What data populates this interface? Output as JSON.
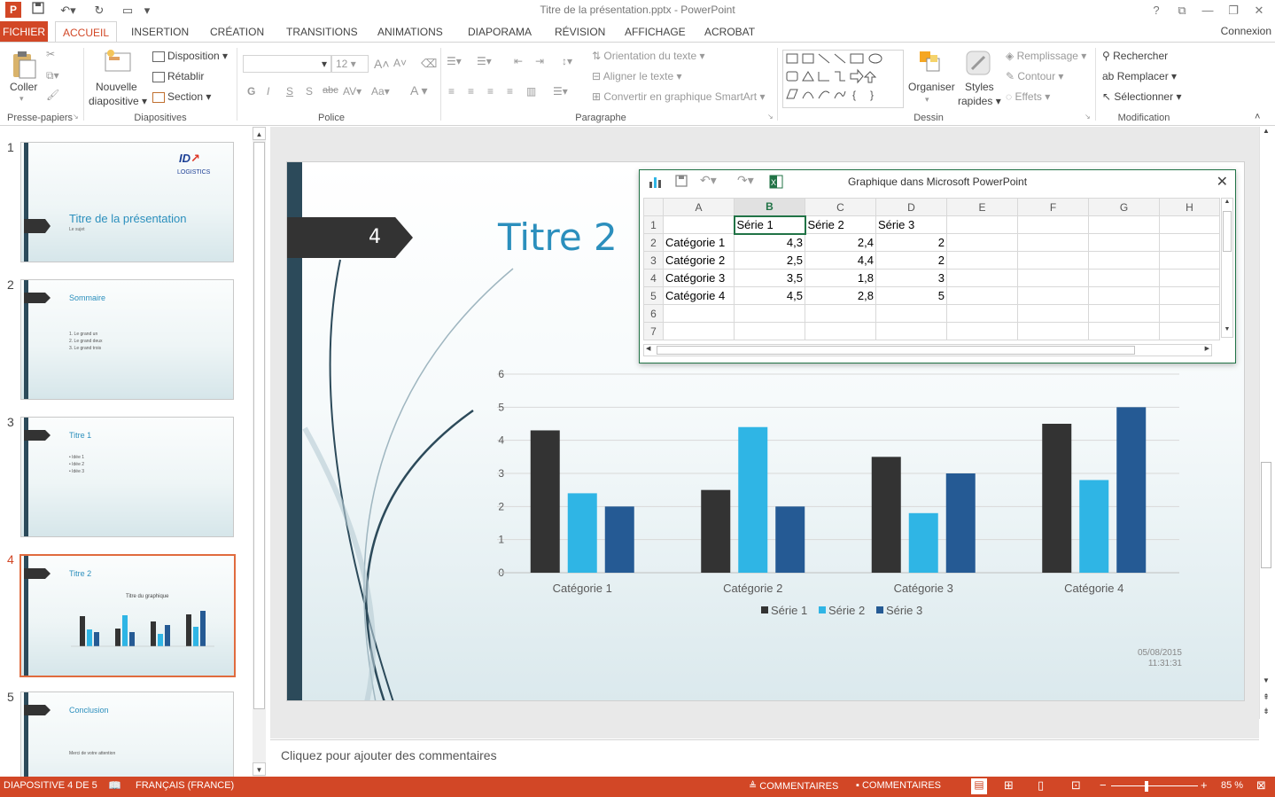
{
  "window": {
    "title": "Titre de la présentation.pptx - PowerPoint",
    "help": "?",
    "controls": [
      "?",
      "⧉",
      "—",
      "❐",
      "✕"
    ]
  },
  "tabs": [
    "FICHIER",
    "ACCUEIL",
    "INSERTION",
    "CRÉATION",
    "TRANSITIONS",
    "ANIMATIONS",
    "DIAPORAMA",
    "RÉVISION",
    "AFFICHAGE",
    "ACROBAT"
  ],
  "connexion": "Connexion",
  "ribbon": {
    "clipboard": {
      "paste": "Coller",
      "label": "Presse-papiers"
    },
    "slides": {
      "new_slide_1": "Nouvelle",
      "new_slide_2": "diapositive",
      "layout": "Disposition",
      "reset": "Rétablir",
      "section": "Section",
      "label": "Diapositives"
    },
    "font": {
      "size": "12",
      "bold": "G",
      "italic": "I",
      "underline": "S",
      "shadow": "S",
      "strike": "abc",
      "spacing": "AV",
      "case": "Aa",
      "color": "A",
      "label": "Police"
    },
    "paragraph": {
      "orientation": "Orientation du texte",
      "align": "Aligner le texte",
      "smartart": "Convertir en graphique SmartArt",
      "label": "Paragraphe"
    },
    "drawing": {
      "arrange": "Organiser",
      "styles_1": "Styles",
      "styles_2": "rapides",
      "fill": "Remplissage",
      "outline": "Contour",
      "effects": "Effets",
      "label": "Dessin"
    },
    "editing": {
      "find": "Rechercher",
      "replace": "Remplacer",
      "select": "Sélectionner",
      "label": "Modification"
    }
  },
  "thumbnails": [
    {
      "num": "1",
      "title": "Titre de la présentation",
      "sub": "Le sujet",
      "logo": "ID LOGISTICS"
    },
    {
      "num": "2",
      "title": "Sommaire",
      "items": [
        "1. Le grand un",
        "2. Le grand deux",
        "3. Le grand trois"
      ]
    },
    {
      "num": "3",
      "title": "Titre 1",
      "items": [
        "Idée 1",
        "Idée 2",
        "Idée 3"
      ]
    },
    {
      "num": "4",
      "title": "Titre 2",
      "chart_title": "Titre du graphique"
    },
    {
      "num": "5",
      "title": "Conclusion",
      "body": "Merci de votre attention"
    }
  ],
  "slide": {
    "number": "4",
    "title": "Titre 2",
    "date": "05/08/2015",
    "time": "11:31:31"
  },
  "datawindow": {
    "title": "Graphique dans Microsoft PowerPoint",
    "columns": [
      "",
      "A",
      "B",
      "C",
      "D",
      "E",
      "F",
      "G",
      "H"
    ],
    "rows": [
      [
        "1",
        "",
        "Série 1",
        "Série 2",
        "Série 3",
        "",
        "",
        "",
        ""
      ],
      [
        "2",
        "Catégorie 1",
        "4,3",
        "2,4",
        "2",
        "",
        "",
        "",
        ""
      ],
      [
        "3",
        "Catégorie 2",
        "2,5",
        "4,4",
        "2",
        "",
        "",
        "",
        ""
      ],
      [
        "4",
        "Catégorie 3",
        "3,5",
        "1,8",
        "3",
        "",
        "",
        "",
        ""
      ],
      [
        "5",
        "Catégorie 4",
        "4,5",
        "2,8",
        "5",
        "",
        "",
        "",
        ""
      ],
      [
        "6",
        "",
        "",
        "",
        "",
        "",
        "",
        "",
        ""
      ],
      [
        "7",
        "",
        "",
        "",
        "",
        "",
        "",
        "",
        ""
      ]
    ]
  },
  "chart_data": {
    "type": "bar",
    "title": "",
    "categories": [
      "Catégorie 1",
      "Catégorie 2",
      "Catégorie 3",
      "Catégorie 4"
    ],
    "series": [
      {
        "name": "Série 1",
        "values": [
          4.3,
          2.5,
          3.5,
          4.5
        ],
        "color": "#333333"
      },
      {
        "name": "Série 2",
        "values": [
          2.4,
          4.4,
          1.8,
          2.8
        ],
        "color": "#2fb5e5"
      },
      {
        "name": "Série 3",
        "values": [
          2,
          2,
          3,
          5
        ],
        "color": "#255a94"
      }
    ],
    "ylim": [
      0,
      6
    ],
    "yticks": [
      "0",
      "1",
      "2",
      "3",
      "4",
      "5",
      "6"
    ],
    "grid": true,
    "legend": "bottom"
  },
  "notes": "Cliquez pour ajouter des commentaires",
  "status": {
    "slide": "DIAPOSITIVE 4 DE 5",
    "language": "FRANÇAIS (FRANCE)",
    "notes": "COMMENTAIRES",
    "comments": "COMMENTAIRES",
    "zoom": "85 %"
  }
}
